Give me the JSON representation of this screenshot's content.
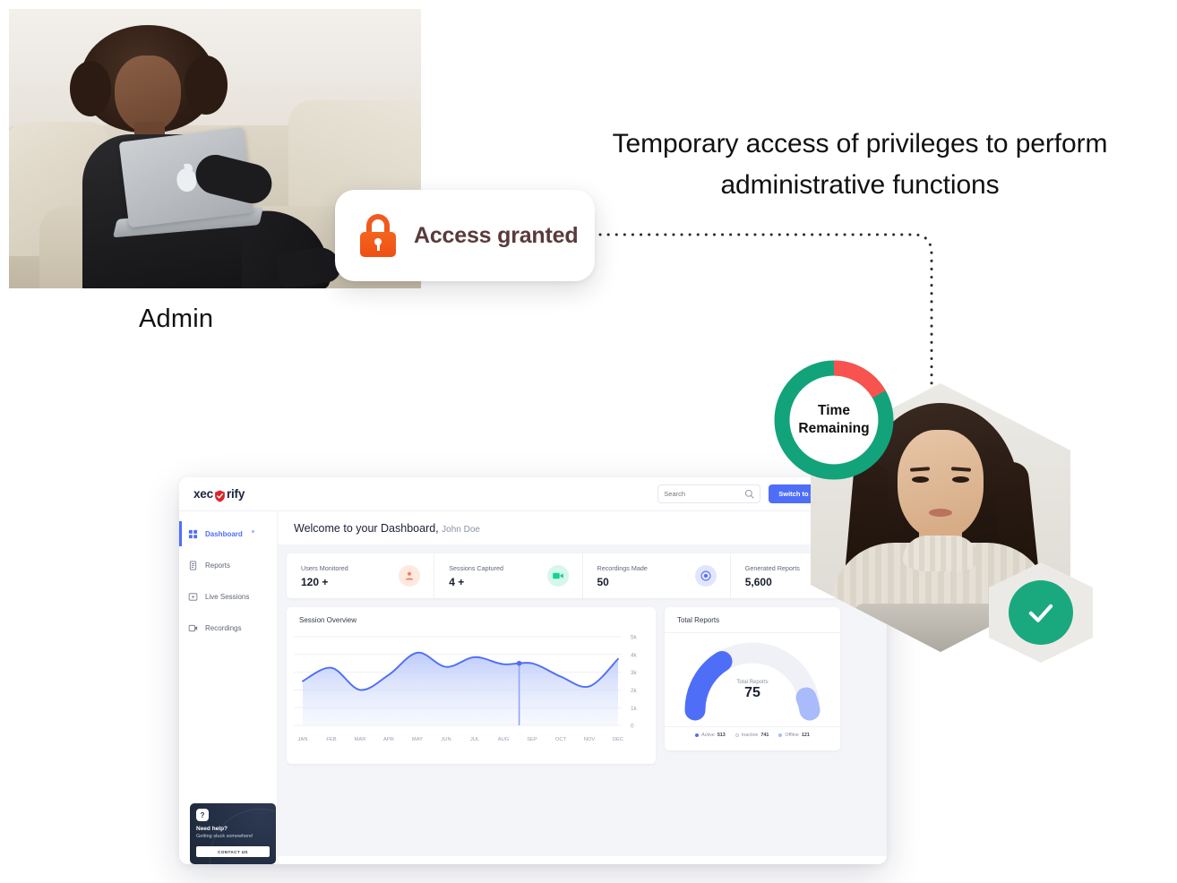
{
  "headline": "Temporary access of privileges to perform administrative functions",
  "admin_label": "Admin",
  "access_card": {
    "label": "Access granted",
    "icon": "lock-icon"
  },
  "time_widget": {
    "line1": "Time",
    "line2": "Remaining",
    "green_hex": "#12a37a",
    "red_hex": "#f9534f"
  },
  "check_badge": {
    "icon": "check-icon",
    "color": "#1aa97f"
  },
  "dashboard": {
    "logo": {
      "text_before": "xec",
      "text_after": "rify",
      "mark": "shield-check-icon"
    },
    "search": {
      "placeholder": "Search",
      "value": "",
      "icon": "search-icon"
    },
    "admin_button": "Switch to Admin Dashboard",
    "sidebar": [
      {
        "label": "Dashboard",
        "icon": "grid-icon",
        "active": true,
        "badge": true
      },
      {
        "label": "Reports",
        "icon": "document-icon",
        "active": false,
        "badge": false
      },
      {
        "label": "Live Sessions",
        "icon": "monitor-play-icon",
        "active": false,
        "badge": false
      },
      {
        "label": "Recordings",
        "icon": "video-record-icon",
        "active": false,
        "badge": false
      }
    ],
    "help": {
      "title": "Need help?",
      "subtitle": "Getting stuck somewhere!",
      "button": "CONTACT US",
      "icon": "question-mark-icon"
    },
    "welcome": {
      "text": "Welcome to your Dashboard,",
      "user": "John Doe"
    },
    "stats": [
      {
        "label": "Users Monitored",
        "value": "120 +",
        "icon": "user-icon",
        "bg": "#fde9e0",
        "fg": "#f08060"
      },
      {
        "label": "Sessions Captured",
        "value": "4 +",
        "icon": "video-camera-icon",
        "bg": "#d6f7ea",
        "fg": "#13d39a"
      },
      {
        "label": "Recordings Made",
        "value": "50",
        "icon": "record-dot-icon",
        "bg": "#e2e6fd",
        "fg": "#4f6ef7"
      },
      {
        "label": "Generated Reports",
        "value": "5,600",
        "icon": "clipboard-icon",
        "bg": "#fdf3d9",
        "fg": "#e9c45f"
      }
    ]
  },
  "chart_data": [
    {
      "type": "area",
      "title": "Session Overview",
      "xlabel": "",
      "ylabel": "",
      "ylim": [
        0,
        5000
      ],
      "ytick_labels": [
        "0",
        "1k",
        "2k",
        "3k",
        "4k",
        "5k"
      ],
      "yticks": [
        0,
        1000,
        2000,
        3000,
        4000,
        5000
      ],
      "grid": true,
      "categories": [
        "JAN",
        "FEB",
        "MAR",
        "APR",
        "MAY",
        "JUN",
        "JUL",
        "AUG",
        "SEP",
        "OCT",
        "NOV",
        "DEC"
      ],
      "values": [
        2500,
        3250,
        2000,
        2850,
        4100,
        3300,
        3850,
        3450,
        3500,
        2750,
        2200,
        3750
      ],
      "marker": {
        "x_category": "AUG",
        "value": 3500,
        "color": "#4f6ef7",
        "has_vertical_rule": true
      },
      "line_color": "#4f6ef7",
      "fill_color": "#c9d4fb",
      "legend": null
    },
    {
      "type": "pie",
      "subtype": "gauge-donut",
      "title": "Total Reports",
      "center_label": "Total Reports",
      "center_value": "75",
      "legend_position": "bottom",
      "labels": [
        "Active",
        "Inactive",
        "Offline"
      ],
      "values": [
        513,
        741,
        121
      ],
      "colors": [
        "#4f6ef7",
        "#f0f1f7",
        "#a9bbfb"
      ],
      "legend": [
        {
          "name": "Active",
          "value": "513",
          "color": "#4f6ef7"
        },
        {
          "name": "Inactive",
          "value": "741",
          "color": "#ffffff"
        },
        {
          "name": "Offline",
          "value": "121",
          "color": "#a9bbfb"
        }
      ]
    }
  ]
}
